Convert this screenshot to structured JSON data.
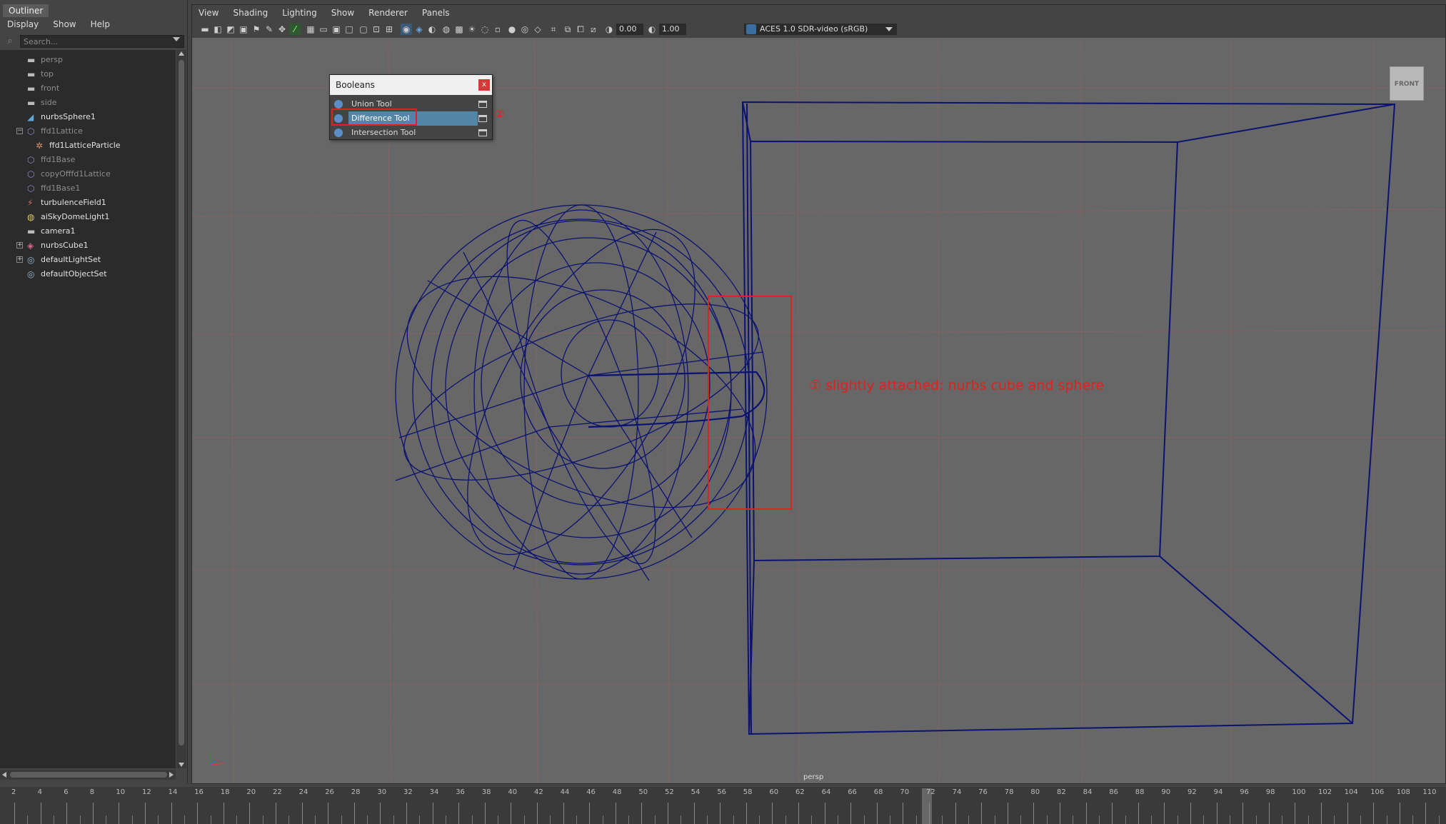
{
  "outliner": {
    "tab_title": "Outliner",
    "menu": [
      "Display",
      "Show",
      "Help"
    ],
    "search_placeholder": "Search...",
    "items": [
      {
        "label": "persp",
        "icon": "camera-icon",
        "dim": true
      },
      {
        "label": "top",
        "icon": "camera-icon",
        "dim": true
      },
      {
        "label": "front",
        "icon": "camera-icon",
        "dim": true
      },
      {
        "label": "side",
        "icon": "camera-icon",
        "dim": true
      },
      {
        "label": "nurbsSphere1",
        "icon": "nurbs-surface-icon",
        "dim": false
      },
      {
        "label": "ffd1Lattice",
        "icon": "lattice-icon",
        "dim": true
      },
      {
        "label": "ffd1LatticeParticle",
        "icon": "particle-icon",
        "dim": false
      },
      {
        "label": "ffd1Base",
        "icon": "lattice-icon",
        "dim": true
      },
      {
        "label": "copyOfffd1Lattice",
        "icon": "lattice-icon",
        "dim": true
      },
      {
        "label": "ffd1Base1",
        "icon": "lattice-icon",
        "dim": true
      },
      {
        "label": "turbulenceField1",
        "icon": "turbulence-field-icon",
        "dim": false
      },
      {
        "label": "aiSkyDomeLight1",
        "icon": "sky-dome-light-icon",
        "dim": false
      },
      {
        "label": "camera1",
        "icon": "camera-icon",
        "dim": false
      },
      {
        "label": "nurbsCube1",
        "icon": "nurbs-cube-icon",
        "dim": false
      },
      {
        "label": "defaultLightSet",
        "icon": "set-icon",
        "dim": false
      },
      {
        "label": "defaultObjectSet",
        "icon": "set-icon",
        "dim": false
      }
    ]
  },
  "viewport": {
    "menu": [
      "View",
      "Shading",
      "Lighting",
      "Show",
      "Renderer",
      "Panels"
    ],
    "exposure": "0.00",
    "gamma": "1.00",
    "colorspace": "ACES 1.0 SDR-video (sRGB)",
    "camera_label": "persp",
    "viewcube_label": "FRONT",
    "annotation": "① slightly attached: nurbs cube and sphere",
    "annotation_step2": "②"
  },
  "booleans_menu": {
    "title": "Booleans",
    "close": "x",
    "items": [
      "Union Tool",
      "Difference Tool",
      "Intersection Tool"
    ],
    "selected": "Difference Tool"
  },
  "timeline": {
    "ticks": [
      "2",
      "4",
      "6",
      "8",
      "10",
      "12",
      "14",
      "16",
      "18",
      "20",
      "22",
      "24",
      "26",
      "28",
      "30",
      "32",
      "34",
      "36",
      "38",
      "40",
      "42",
      "44",
      "46",
      "48",
      "50",
      "52",
      "54",
      "56",
      "58",
      "60",
      "62",
      "64",
      "66",
      "68",
      "70",
      "72",
      "74",
      "76",
      "78",
      "80",
      "82",
      "84",
      "86",
      "88",
      "90",
      "92",
      "94",
      "96",
      "98",
      "100",
      "102",
      "104",
      "106",
      "108",
      "110"
    ]
  },
  "colors": {
    "wireframe": "#0c1270",
    "annotation": "#dd2222",
    "selection": "#5285a6",
    "grid": "#b06060"
  }
}
